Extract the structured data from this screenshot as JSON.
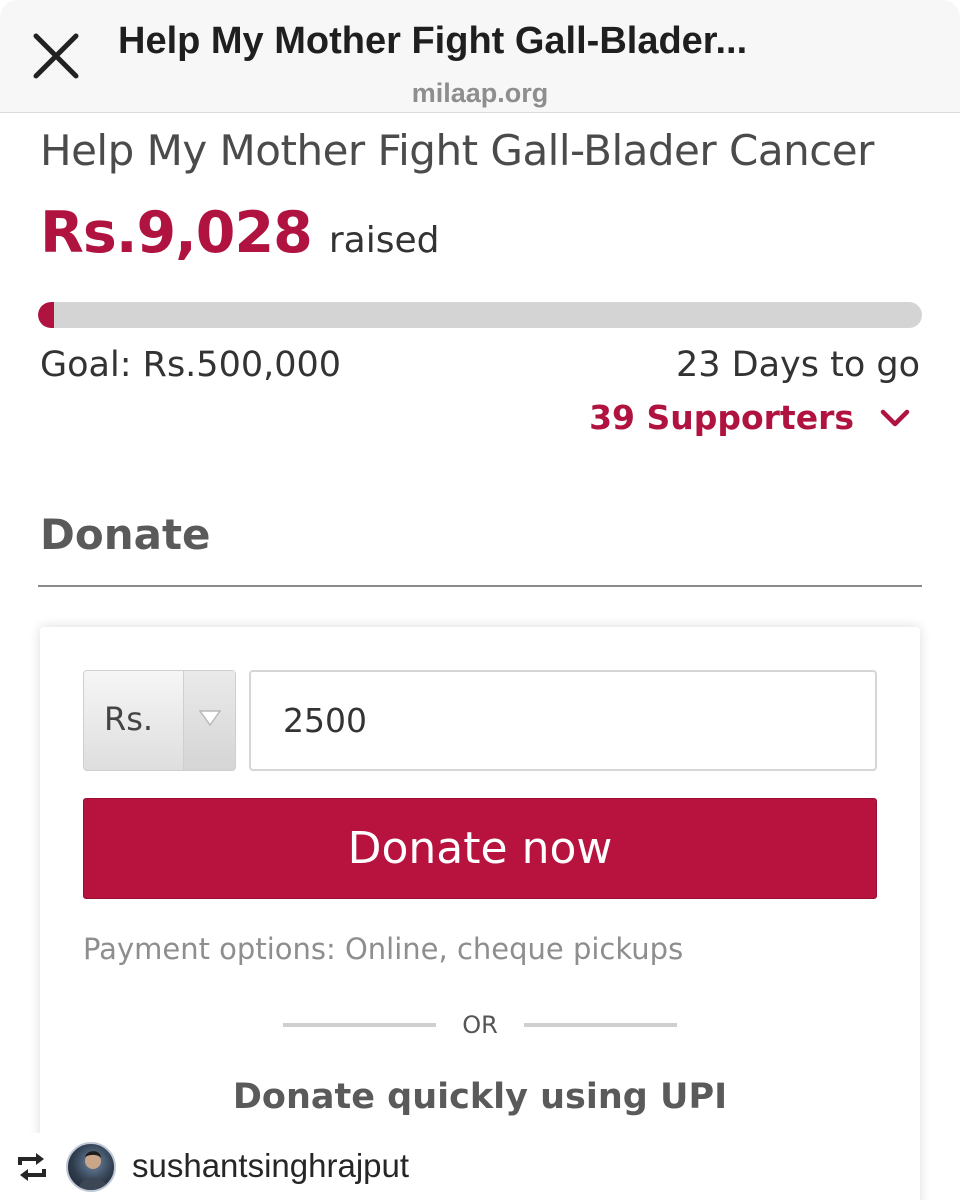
{
  "browser": {
    "title": "Help My Mother Fight Gall-Blader...",
    "domain": "milaap.org",
    "close_icon": "close-icon"
  },
  "campaign": {
    "title": "Help My Mother Fight Gall-Blader Cancer",
    "raised_amount": "Rs.9,028",
    "raised_label": "raised",
    "progress_fraction": 0.018,
    "goal": "Goal: Rs.500,000",
    "days_left": "23 Days to go",
    "supporters": "39 Supporters",
    "accent_color": "#b01340"
  },
  "donate": {
    "heading": "Donate",
    "currency": "Rs.",
    "amount": "2500",
    "button_label": "Donate now",
    "payment_options": "Payment options: Online, cheque pickups",
    "or_label": "OR",
    "upi_label": "Donate quickly using UPI"
  },
  "repost": {
    "icon": "repost-icon",
    "username": "sushantsinghrajput"
  }
}
